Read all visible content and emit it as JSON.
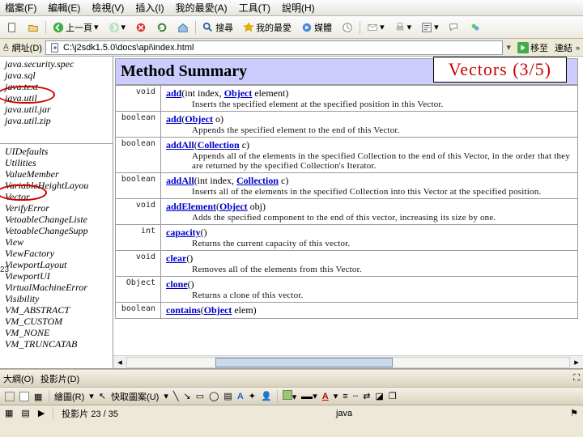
{
  "menu": {
    "file": "檔案(F)",
    "edit": "編輯(E)",
    "view": "檢視(V)",
    "insert": "插入(I)",
    "favorites": "我的最愛(A)",
    "tools": "工具(T)",
    "help": "說明(H)"
  },
  "tb": {
    "back": "上一頁",
    "search": "搜尋",
    "fav": "我的最愛",
    "media": "媒體"
  },
  "addr_label": "網址(D)",
  "addr_value": "C:\\j2sdk1.5.0\\docs\\api\\index.html",
  "go": "移至",
  "links": "連結",
  "packages": [
    "java.security.spec",
    "java.sql",
    "java.text",
    "java.util",
    "java.util.jar",
    "java.util.zip"
  ],
  "class_top": [
    "UIDefaults",
    "Utilities",
    "ValueMember",
    "VariableHeightLayou",
    "Vector",
    "VerifyError",
    "VetoableChangeListe",
    "VetoableChangeSupp",
    "View",
    "ViewFactory",
    "ViewportLayout",
    "ViewportUI",
    "VirtualMachineError",
    "Visibility",
    "VM_ABSTRACT",
    "VM_CUSTOM",
    "VM_NONE",
    "VM_TRUNCATAB"
  ],
  "overlay": "Vectors (3/5)",
  "method_summary_title": "Method Summary",
  "methods": [
    {
      "rt": "void",
      "sig": "add(int index, Object element)",
      "desc": "Inserts the specified element at the specified position in this Vector."
    },
    {
      "rt": "boolean",
      "sig": "add(Object o)",
      "desc": "Appends the specified element to the end of this Vector."
    },
    {
      "rt": "boolean",
      "sig": "addAll(Collection c)",
      "desc": "Appends all of the elements in the specified Collection to the end of this Vector, in the order that they are returned by the specified Collection's Iterator."
    },
    {
      "rt": "boolean",
      "sig": "addAll(int index, Collection c)",
      "desc": "Inserts all of the elements in the specified Collection into this Vector at the specified position."
    },
    {
      "rt": "void",
      "sig": "addElement(Object obj)",
      "desc": "Adds the specified component to the end of this vector, increasing its size by one."
    },
    {
      "rt": "int",
      "sig": "capacity()",
      "desc": "Returns the current capacity of this vector."
    },
    {
      "rt": "void",
      "sig": "clear()",
      "desc": "Removes all of the elements from this Vector."
    },
    {
      "rt": "Object",
      "sig": "clone()",
      "desc": "Returns a clone of this vector."
    },
    {
      "rt": "boolean",
      "sig": "contains(Object elem)",
      "desc": ""
    }
  ],
  "ppt": {
    "outline": "大綱(O)",
    "slide": "投影片(D)"
  },
  "draw": {
    "label": "繪圖(R)",
    "autoshape": "快取圖案(U)"
  },
  "status": {
    "slide": "投影片 23 / 35",
    "lang": "java"
  }
}
